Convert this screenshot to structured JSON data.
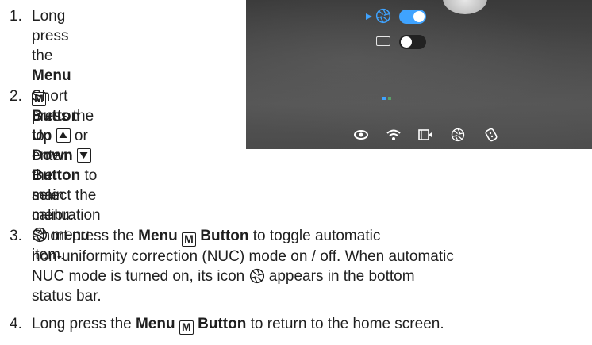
{
  "steps": [
    {
      "n": "1.",
      "l1a": "Long press the ",
      "l1b": "Menu",
      "l2a": "Button",
      "l2b": " to enter",
      "l3": "the main menu."
    },
    {
      "n": "2.",
      "l1": "Short press the",
      "l2a": "Up",
      "l2b": " or ",
      "l2c": "Down",
      "l3a": "Button",
      "l3b": " to select the",
      "l4a": "calibration ",
      "l4b": " menu",
      "l5": "item."
    },
    {
      "n": "3.",
      "l1a": "Short press the ",
      "l1b": "Menu",
      "l1c": "Button",
      "l1d": " to toggle automatic",
      "l2": "non-uniformity correction (NUC) mode on / off. When automatic",
      "l3a": "NUC mode is turned on, its icon ",
      "l3b": " appears in the bottom",
      "l4": "status bar."
    },
    {
      "n": "4.",
      "l1a": "Long press the ",
      "l1b": "Menu",
      "l1c": "Button",
      "l1d": " to return to the home screen."
    }
  ],
  "keys": {
    "menu": "M"
  },
  "screen": {
    "toggles": [
      {
        "icon": "calibration-icon",
        "state": "on",
        "selected": true
      },
      {
        "icon": "ui-icon",
        "state": "off",
        "selected": false
      }
    ],
    "status_bar_icons": [
      "eye-icon",
      "wifi-icon",
      "video-icon",
      "nuc-icon",
      "remote-icon"
    ],
    "accent": "#3fa3ff"
  }
}
